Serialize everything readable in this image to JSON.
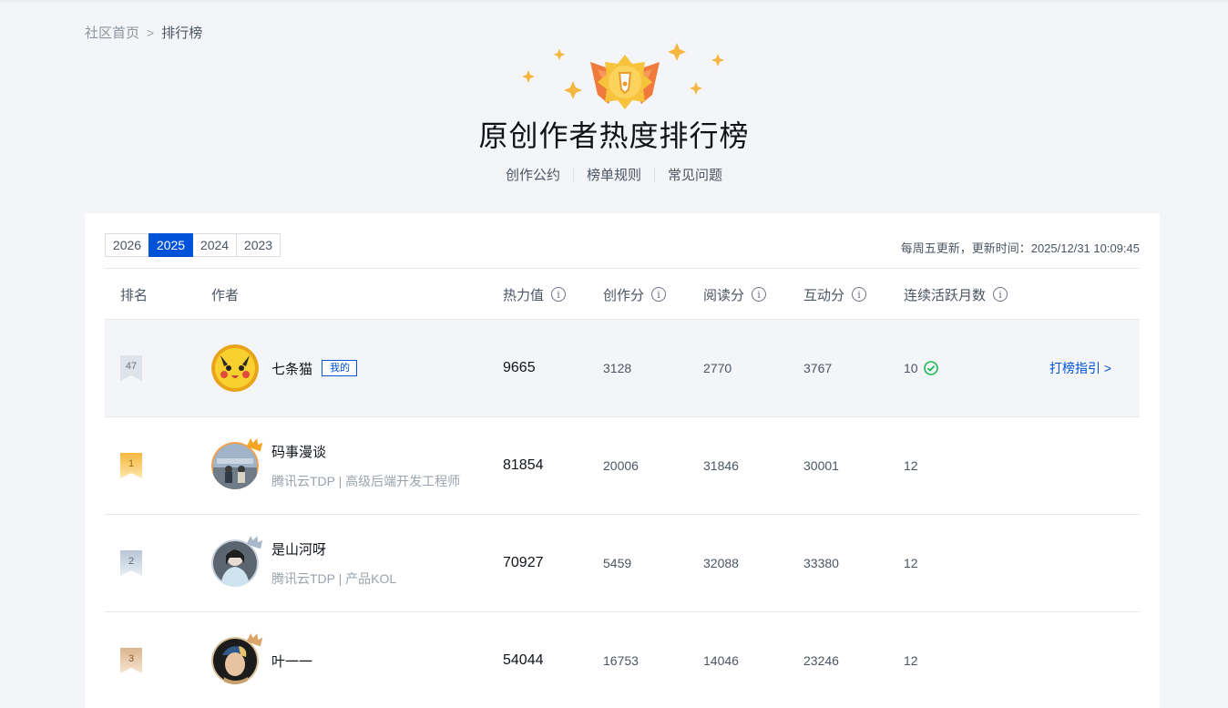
{
  "breadcrumb": {
    "home": "社区首页",
    "separator": ">",
    "current": "排行榜"
  },
  "hero": {
    "title": "原创作者热度排行榜",
    "links": [
      "创作公约",
      "榜单规则",
      "常见问题"
    ]
  },
  "year_tabs": {
    "years": [
      "2026",
      "2025",
      "2024",
      "2023"
    ],
    "active": "2025"
  },
  "update_info": "每周五更新，更新时间：2025/12/31 10:09:45",
  "table": {
    "headers": {
      "rank": "排名",
      "author": "作者",
      "heat": "热力值",
      "create": "创作分",
      "read": "阅读分",
      "interact": "互动分",
      "active_months": "连续活跃月数"
    },
    "my_row": {
      "rank": "47",
      "name": "七条猫",
      "tag": "我的",
      "heat": "9665",
      "create": "3128",
      "read": "2770",
      "interact": "3767",
      "active_months": "10",
      "guide": "打榜指引 >"
    },
    "rows": [
      {
        "rank": "1",
        "name": "码事漫谈",
        "sub": "腾讯云TDP | 高级后端开发工程师",
        "heat": "81854",
        "create": "20006",
        "read": "31846",
        "interact": "30001",
        "active_months": "12"
      },
      {
        "rank": "2",
        "name": "是山河呀",
        "sub": "腾讯云TDP | 产品KOL",
        "heat": "70927",
        "create": "5459",
        "read": "32088",
        "interact": "33380",
        "active_months": "12"
      },
      {
        "rank": "3",
        "name": "叶一一",
        "sub": "",
        "heat": "54044",
        "create": "16753",
        "read": "14046",
        "interact": "23246",
        "active_months": "12"
      }
    ]
  },
  "colors": {
    "accent": "#0052d9",
    "gold": "#f5b740",
    "silver": "#b8c6d6",
    "bronze": "#dcb58e",
    "check": "#1db954"
  }
}
